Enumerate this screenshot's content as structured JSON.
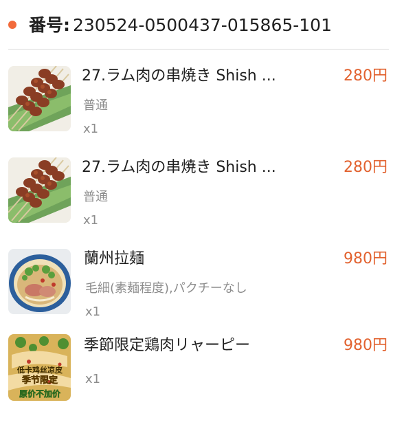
{
  "order": {
    "label": "番号:",
    "number": "230524-0500437-015865-101"
  },
  "items": [
    {
      "name": "27.ラム肉の串焼き Shish ...",
      "price": "280円",
      "option": "普通",
      "qty": "x1",
      "image": "lamb-skewers-photo"
    },
    {
      "name": "27.ラム肉の串焼き Shish ...",
      "price": "280円",
      "option": "普通",
      "qty": "x1",
      "image": "lamb-skewers-photo"
    },
    {
      "name": "蘭州拉麺",
      "price": "980円",
      "option": "毛細(素麺程度),パクチーなし",
      "qty": "x1",
      "image": "lanzhou-noodle-photo"
    },
    {
      "name": "季節限定鶏肉リャーピー",
      "price": "980円",
      "option": "",
      "qty": "x1",
      "image": "chicken-liangpi-photo",
      "image_text": [
        "低卡鸡丝凉皮",
        "季节限定",
        "原价不加价"
      ]
    }
  ],
  "colors": {
    "accent": "#f26a3b",
    "price": "#e2622f",
    "muted": "#8d8d8d"
  }
}
